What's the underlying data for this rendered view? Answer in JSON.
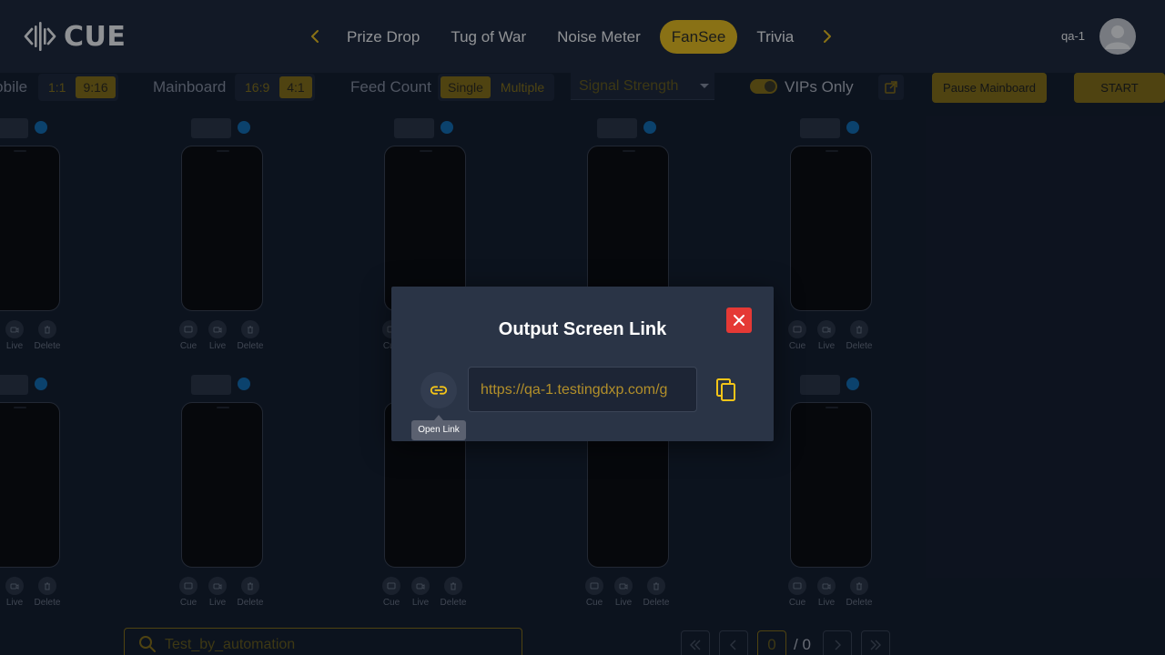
{
  "header": {
    "logo_text": "CUE",
    "nav_tabs": [
      {
        "label": "Prize Drop",
        "active": false
      },
      {
        "label": "Tug of War",
        "active": false
      },
      {
        "label": "Noise Meter",
        "active": false
      },
      {
        "label": "FanSee",
        "active": true
      },
      {
        "label": "Trivia",
        "active": false
      }
    ],
    "user_name": "qa-1"
  },
  "toolbar": {
    "mobile": {
      "label": "Mobile",
      "options": [
        "1:1",
        "9:16"
      ],
      "selected": "9:16"
    },
    "mainboard": {
      "label": "Mainboard",
      "options": [
        "16:9",
        "4:1"
      ],
      "selected": "4:1"
    },
    "feed_count": {
      "label": "Feed Count",
      "options": [
        "Single",
        "Multiple"
      ],
      "selected": "Single"
    },
    "signal_dropdown": {
      "placeholder": "Signal Strength"
    },
    "vip_toggle": {
      "label": "VIPs Only",
      "on": true
    },
    "pause_label": "Pause Mainboard",
    "start_label": "START"
  },
  "card_controls": {
    "cue": "Cue",
    "live": "Live",
    "delete": "Delete"
  },
  "search": {
    "placeholder": "Test_by_automation"
  },
  "pagination": {
    "current": "0",
    "total": "/ 0"
  },
  "modal": {
    "title": "Output Screen Link",
    "url": "https://qa-1.testingdxp.com/g",
    "tooltip": "Open Link"
  },
  "colors": {
    "accent": "#f5c518",
    "accent_dim": "#8b7212",
    "background": "#121a29",
    "header": "#1d2637",
    "modal": "#2a3446",
    "close": "#e53935",
    "status_dot": "#0f6fb8"
  }
}
